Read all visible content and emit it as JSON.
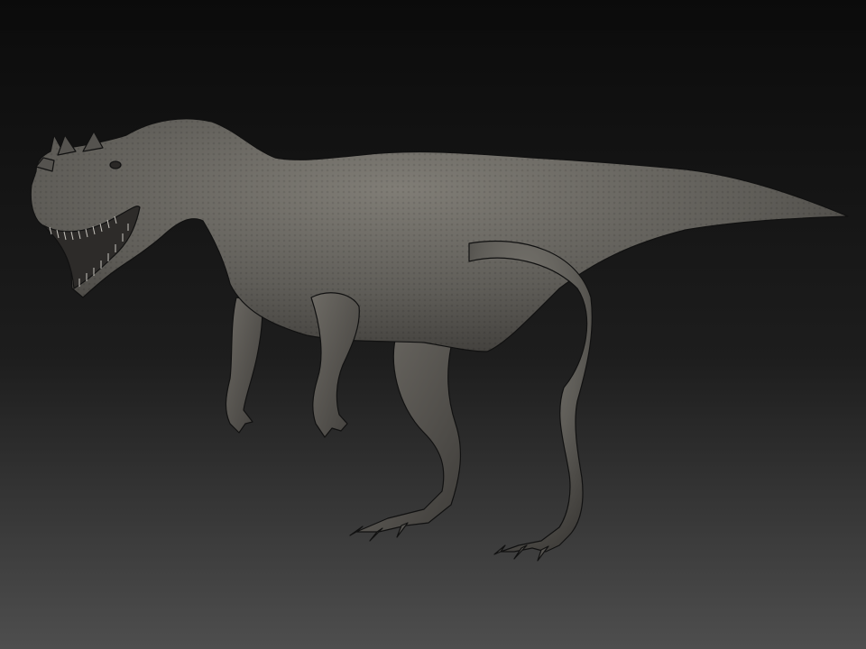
{
  "scene": {
    "subject": "dinosaur-sculpt",
    "background_top": "#0b0b0b",
    "background_bottom": "#4e4e4e",
    "model_color": "#5f5d58",
    "model_shadow": "#3a3835",
    "model_highlight": "#807d76",
    "outline_color": "#111111"
  }
}
